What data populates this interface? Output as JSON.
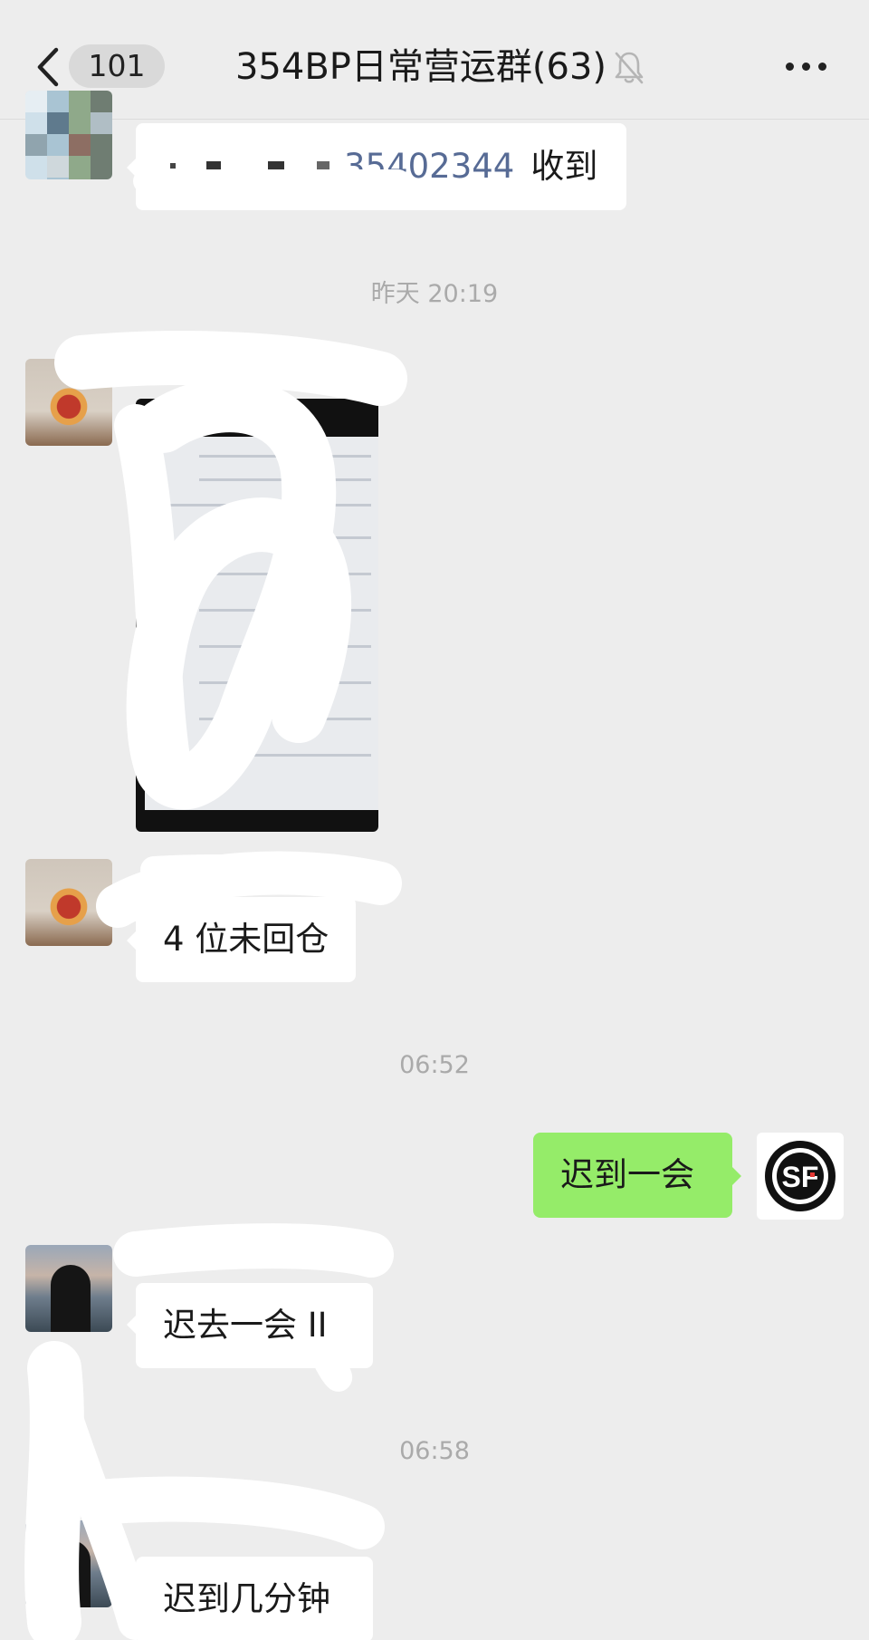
{
  "header": {
    "back_count": "101",
    "title": "354BP日常营运群(63)",
    "icons": [
      "chevron-left-icon",
      "bell-mute-icon",
      "more-icon"
    ]
  },
  "messages": [
    {
      "type": "text",
      "side": "left",
      "text_suffix": "35402344",
      "text_after": "收到"
    },
    {
      "type": "timestamp",
      "text": "昨天 20:19"
    },
    {
      "type": "image",
      "side": "left"
    },
    {
      "type": "text",
      "side": "left",
      "text": "4 位未回仓"
    },
    {
      "type": "timestamp",
      "text": "06:52"
    },
    {
      "type": "text",
      "side": "right",
      "text": "迟到一会"
    },
    {
      "type": "text",
      "side": "left",
      "text": "迟去一会 II"
    },
    {
      "type": "timestamp",
      "text": "06:58"
    },
    {
      "type": "text",
      "side": "left",
      "text": "迟到几分钟"
    }
  ],
  "colors": {
    "background": "#ededed",
    "own_bubble": "#95ec69",
    "other_bubble": "#ffffff",
    "link": "#576b95",
    "timestamp": "#aaaaaa"
  },
  "sf_logo_text": "SF"
}
